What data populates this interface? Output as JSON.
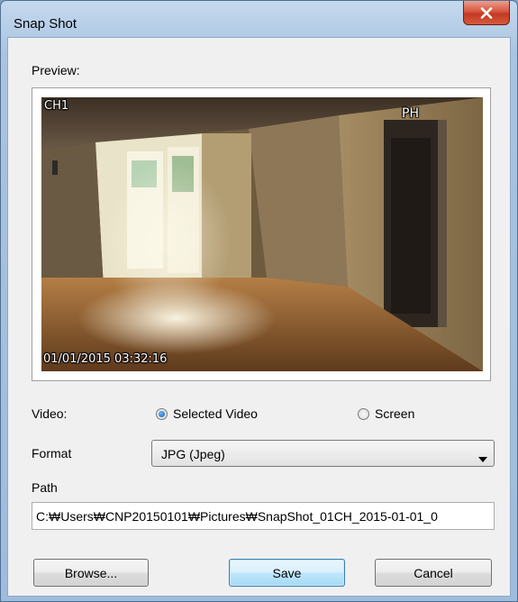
{
  "window": {
    "title": "Snap Shot",
    "close_icon": "close-icon"
  },
  "preview": {
    "label": "Preview:",
    "channel_osd": "CH1",
    "timestamp_osd": "01/01/2015 03:32:16",
    "sign_text": "PH"
  },
  "video": {
    "label": "Video:",
    "options": [
      {
        "label": "Selected Video",
        "selected": true
      },
      {
        "label": "Screen",
        "selected": false
      }
    ]
  },
  "format": {
    "label": "Format",
    "selected": "JPG (Jpeg)"
  },
  "path": {
    "label": "Path",
    "value": "C:₩Users₩CNP20150101₩Pictures₩SnapShot_01CH_2015-01-01_0"
  },
  "buttons": {
    "browse": "Browse...",
    "save": "Save",
    "cancel": "Cancel"
  },
  "colors": {
    "title_bar": "#b8cfe8",
    "close_button": "#c9452e",
    "default_button": "#bee6fd",
    "radio_selected": "#1a5fb4"
  }
}
